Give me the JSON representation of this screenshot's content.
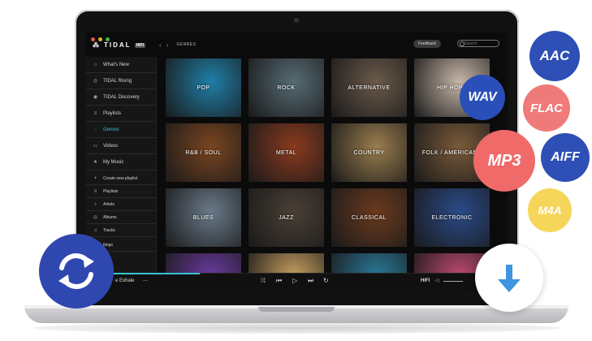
{
  "app": {
    "logo": "TIDAL",
    "logo_badge": "HIFI"
  },
  "topbar": {
    "back": "‹",
    "forward": "›",
    "page": "GENRES",
    "feedback": "Feedback",
    "search_placeholder": "Search"
  },
  "sidebar": {
    "items": [
      {
        "icon": "⌂",
        "label": "What's New"
      },
      {
        "icon": "◎",
        "label": "TIDAL Rising"
      },
      {
        "icon": "◉",
        "label": "TIDAL Discovery"
      },
      {
        "icon": "≡",
        "label": "Playlists"
      },
      {
        "icon": "◌",
        "label": "Genres"
      },
      {
        "icon": "▭",
        "label": "Videos"
      },
      {
        "icon": "★",
        "label": "My Music"
      },
      {
        "icon": "+",
        "label": "Create new playlist"
      },
      {
        "icon": "≡",
        "label": "Playlists"
      },
      {
        "icon": "♪",
        "label": "Artists"
      },
      {
        "icon": "◎",
        "label": "Albums"
      },
      {
        "icon": "♫",
        "label": "Tracks"
      },
      {
        "icon": "⚙",
        "label": "ttings"
      }
    ],
    "active": "Genres"
  },
  "genres": [
    {
      "label": "POP",
      "color": "#1f7fa8"
    },
    {
      "label": "ROCK",
      "color": "#566b74"
    },
    {
      "label": "ALTERNATIVE",
      "color": "#6b5a4a"
    },
    {
      "label": "HIP HOP /",
      "color": "#c7b6a8"
    },
    {
      "label": "R&B / SOUL",
      "color": "#7a4520"
    },
    {
      "label": "METAL",
      "color": "#8a3a1e"
    },
    {
      "label": "COUNTRY",
      "color": "#9a7d4e"
    },
    {
      "label": "FOLK / AMERICANA",
      "color": "#7a5a3a"
    },
    {
      "label": "BLUES",
      "color": "#6a7a8a"
    },
    {
      "label": "JAZZ",
      "color": "#4a3f35"
    },
    {
      "label": "CLASSICAL",
      "color": "#6b3a1e"
    },
    {
      "label": "ELECTRONIC",
      "color": "#2a4b8a"
    },
    {
      "label": "",
      "color": "#6a3aa0"
    },
    {
      "label": "",
      "color": "#c7a060"
    },
    {
      "label": "",
      "color": "#2a7a9a"
    },
    {
      "label": "",
      "color": "#c04a70"
    }
  ],
  "player": {
    "track": "e Exhale",
    "more": "...",
    "shuffle": "⤨",
    "prev": "⏮",
    "play": "▷",
    "next": "⏭",
    "repeat": "↻",
    "quality": "HIFI",
    "volume_icon": "◁"
  },
  "formats": [
    {
      "label": "AAC",
      "color": "#2e4fb5"
    },
    {
      "label": "WAV",
      "color": "#2a4fb8"
    },
    {
      "label": "FLAC",
      "color": "#f07a7a"
    },
    {
      "label": "MP3",
      "color": "#f06a6a"
    },
    {
      "label": "AIFF",
      "color": "#2e4fb5"
    },
    {
      "label": "M4A",
      "color": "#f5d55a"
    }
  ],
  "convert_button_color": "#2f48b0",
  "download_button_color": "#3f95e0"
}
